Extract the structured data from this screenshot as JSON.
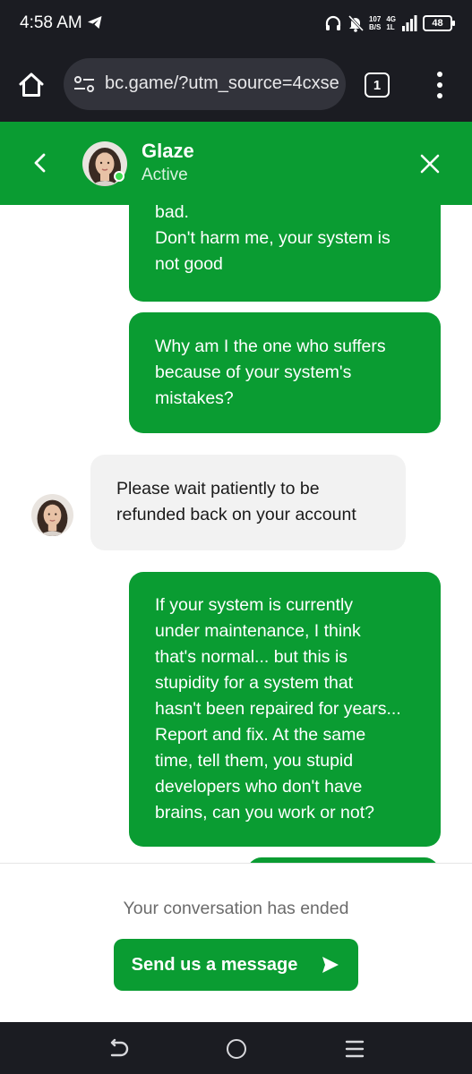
{
  "status_bar": {
    "time": "4:58 AM",
    "speed_value": "107",
    "speed_unit": "B/S",
    "network_type": "4G",
    "network_sub": "1L",
    "battery": "48"
  },
  "browser": {
    "url": "bc.game/?utm_source=4cxse",
    "tab_count": "1"
  },
  "chat_header": {
    "agent_name": "Glaze",
    "agent_status": "Active"
  },
  "messages": [
    {
      "sender": "user",
      "lines": [
        "bad.",
        "Don't harm me, your system is",
        "not good"
      ]
    },
    {
      "sender": "user",
      "lines": [
        "Why am I the one who suffers",
        "because of your system's",
        "mistakes?"
      ]
    },
    {
      "sender": "agent",
      "lines": [
        "Please wait patiently to be",
        "refunded back on your account"
      ]
    },
    {
      "sender": "user",
      "lines": [
        "If your system is currently",
        "under maintenance, I think",
        "that's normal... but this is",
        "stupidity for a system that",
        "hasn't been repaired for years...",
        "Report and fix. At the same",
        "time, tell them, you stupid",
        "developers who don't have",
        "brains, can you work or not?"
      ]
    }
  ],
  "footer": {
    "ended_text": "Your conversation has ended",
    "send_button_label": "Send us a message"
  },
  "colors": {
    "brand_green": "#0a9c32",
    "system_bar": "#1b1c22",
    "agent_bubble": "#f2f2f2"
  },
  "icons": {
    "status": [
      "telegram-icon",
      "headphones-icon",
      "mute-icon",
      "signal-icon",
      "battery-icon"
    ],
    "browser": [
      "home-icon",
      "site-settings-icon",
      "tab-switcher-icon",
      "overflow-menu-icon"
    ],
    "chat": [
      "back-arrow-icon",
      "close-icon",
      "send-icon"
    ],
    "nav": [
      "nav-back-icon",
      "nav-home-icon",
      "nav-recents-icon"
    ]
  }
}
